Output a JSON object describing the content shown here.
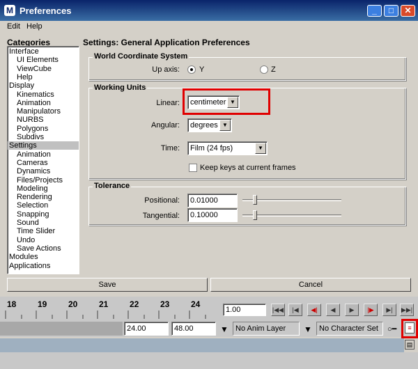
{
  "window": {
    "title": "Preferences"
  },
  "menu": {
    "edit": "Edit",
    "help": "Help"
  },
  "categories": {
    "label": "Categories",
    "items": [
      {
        "label": "Interface",
        "level": 0
      },
      {
        "label": "UI Elements",
        "level": 1
      },
      {
        "label": "ViewCube",
        "level": 1
      },
      {
        "label": "Help",
        "level": 1
      },
      {
        "label": "Display",
        "level": 0
      },
      {
        "label": "Kinematics",
        "level": 1
      },
      {
        "label": "Animation",
        "level": 1
      },
      {
        "label": "Manipulators",
        "level": 1
      },
      {
        "label": "NURBS",
        "level": 1
      },
      {
        "label": "Polygons",
        "level": 1
      },
      {
        "label": "Subdivs",
        "level": 1
      },
      {
        "label": "Settings",
        "level": 0,
        "selected": true
      },
      {
        "label": "Animation",
        "level": 1
      },
      {
        "label": "Cameras",
        "level": 1
      },
      {
        "label": "Dynamics",
        "level": 1
      },
      {
        "label": "Files/Projects",
        "level": 1
      },
      {
        "label": "Modeling",
        "level": 1
      },
      {
        "label": "Rendering",
        "level": 1
      },
      {
        "label": "Selection",
        "level": 1
      },
      {
        "label": "Snapping",
        "level": 1
      },
      {
        "label": "Sound",
        "level": 1
      },
      {
        "label": "Time Slider",
        "level": 1
      },
      {
        "label": "Undo",
        "level": 1
      },
      {
        "label": "Save Actions",
        "level": 1
      },
      {
        "label": "Modules",
        "level": 0
      },
      {
        "label": "Applications",
        "level": 0
      }
    ]
  },
  "settings": {
    "title": "Settings: General Application Preferences",
    "world": {
      "title": "World Coordinate System",
      "up_axis_label": "Up axis:",
      "y_label": "Y",
      "z_label": "Z",
      "selected": "Y"
    },
    "units": {
      "title": "Working Units",
      "linear_label": "Linear:",
      "linear_value": "centimeter",
      "angular_label": "Angular:",
      "angular_value": "degrees",
      "time_label": "Time:",
      "time_value": "Film (24 fps)",
      "keep_keys_label": "Keep keys at current frames",
      "keep_keys_checked": false
    },
    "tolerance": {
      "title": "Tolerance",
      "positional_label": "Positional:",
      "positional_value": "0.01000",
      "tangential_label": "Tangential:",
      "tangential_value": "0.10000"
    }
  },
  "buttons": {
    "save": "Save",
    "cancel": "Cancel"
  },
  "timeline": {
    "ticks": [
      "18",
      "19",
      "20",
      "21",
      "22",
      "23",
      "24"
    ],
    "current_frame": "1.00",
    "range_end": "24.00",
    "anim_end": "48.00",
    "anim_layer": "No Anim Layer",
    "character_set": "No Character Set"
  },
  "colors": {
    "highlight": "#e00000",
    "titlebar": "#0a246a"
  }
}
